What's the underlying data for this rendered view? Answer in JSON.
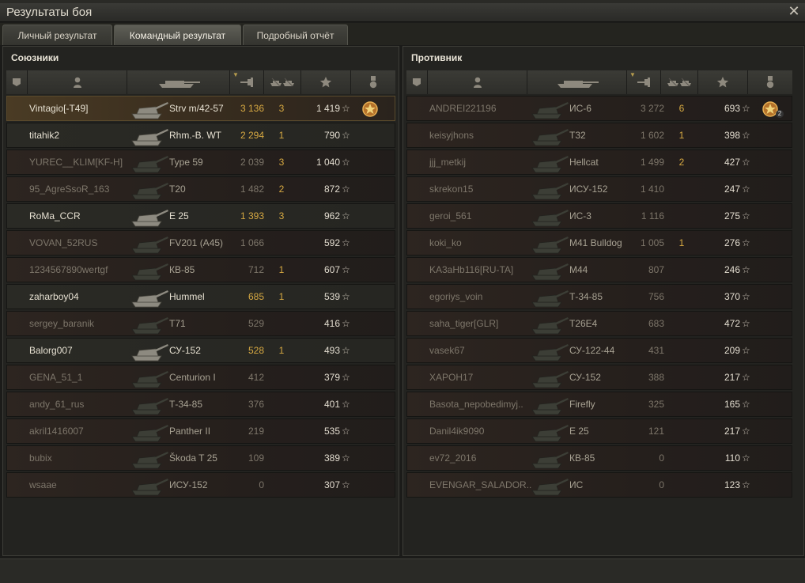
{
  "window": {
    "title": "Результаты боя",
    "close_icon": "close-icon"
  },
  "tabs": [
    {
      "label": "Личный результат"
    },
    {
      "label": "Командный результат"
    },
    {
      "label": "Подробный отчёт"
    }
  ],
  "colors": {
    "gold": "#d7a942",
    "name": "#c8c2b4",
    "dim": "#7d766a",
    "player": "#e6e0d1"
  },
  "allies": {
    "title": "Союзники",
    "rows": [
      {
        "player": "Vintagio[-T49]",
        "tank": "Strv m/42-57",
        "damage": "3 136",
        "kills": "3",
        "xp": "1 419",
        "medal": true,
        "style": "gold",
        "alive": true
      },
      {
        "player": "titahik2",
        "tank": "Rhm.-B. WT",
        "damage": "2 294",
        "kills": "1",
        "xp": "790",
        "style": "alive",
        "alive": true
      },
      {
        "player": "YUREC__KLIM[KF-H]",
        "tank": "Type 59",
        "damage": "2 039",
        "kills": "3",
        "xp": "1 040",
        "style": "dead",
        "alive": false
      },
      {
        "player": "95_AgreSsoR_163",
        "tank": "T20",
        "damage": "1 482",
        "kills": "2",
        "xp": "872",
        "style": "dead",
        "alive": false
      },
      {
        "player": "RoMa_CCR",
        "tank": "E 25",
        "damage": "1 393",
        "kills": "3",
        "xp": "962",
        "style": "alive",
        "alive": true
      },
      {
        "player": "VOVAN_52RUS",
        "tank": "FV201 (A45)",
        "damage": "1 066",
        "kills": "",
        "xp": "592",
        "style": "dead",
        "alive": false
      },
      {
        "player": "1234567890wertgf",
        "tank": "КВ-85",
        "damage": "712",
        "kills": "1",
        "xp": "607",
        "style": "dead",
        "alive": false
      },
      {
        "player": "zaharboy04",
        "tank": "Hummel",
        "damage": "685",
        "kills": "1",
        "xp": "539",
        "style": "alive",
        "alive": true
      },
      {
        "player": "sergey_baranik",
        "tank": "T71",
        "damage": "529",
        "kills": "",
        "xp": "416",
        "style": "dead",
        "alive": false
      },
      {
        "player": "Balorg007",
        "tank": "СУ-152",
        "damage": "528",
        "kills": "1",
        "xp": "493",
        "style": "alive",
        "alive": true
      },
      {
        "player": "GENA_51_1",
        "tank": "Centurion I",
        "damage": "412",
        "kills": "",
        "xp": "379",
        "style": "dead",
        "alive": false
      },
      {
        "player": "andy_61_rus",
        "tank": "Т-34-85",
        "damage": "376",
        "kills": "",
        "xp": "401",
        "style": "dead",
        "alive": false
      },
      {
        "player": "akril1416007",
        "tank": "Panther II",
        "damage": "219",
        "kills": "",
        "xp": "535",
        "style": "dead",
        "alive": false
      },
      {
        "player": "bubix",
        "tank": "Škoda T 25",
        "damage": "109",
        "kills": "",
        "xp": "389",
        "style": "dead",
        "alive": false
      },
      {
        "player": "wsaae",
        "tank": "ИСУ-152",
        "damage": "0",
        "kills": "",
        "xp": "307",
        "style": "dead",
        "alive": false
      }
    ]
  },
  "enemies": {
    "title": "Противник",
    "rows": [
      {
        "player": "ANDREI221196",
        "tank": "ИС-6",
        "damage": "3 272",
        "kills": "6",
        "xp": "693",
        "medal": true,
        "medal_count": "2",
        "style": "dead",
        "alive": false
      },
      {
        "player": "keisyjhons",
        "tank": "T32",
        "damage": "1 602",
        "kills": "1",
        "xp": "398",
        "style": "dead",
        "alive": false
      },
      {
        "player": "jjj_metkij",
        "tank": "Hellcat",
        "damage": "1 499",
        "kills": "2",
        "xp": "427",
        "style": "dead",
        "alive": false
      },
      {
        "player": "skrekon15",
        "tank": "ИСУ-152",
        "damage": "1 410",
        "kills": "",
        "xp": "247",
        "style": "dead",
        "alive": false
      },
      {
        "player": "geroi_561",
        "tank": "ИС-3",
        "damage": "1 116",
        "kills": "",
        "xp": "275",
        "style": "dead",
        "alive": false
      },
      {
        "player": "koki_ko",
        "tank": "M41 Bulldog",
        "damage": "1 005",
        "kills": "1",
        "xp": "276",
        "style": "dead",
        "alive": false
      },
      {
        "player": "KA3aHb116[RU-TA]",
        "tank": "M44",
        "damage": "807",
        "kills": "",
        "xp": "246",
        "style": "dead",
        "alive": false
      },
      {
        "player": "egoriys_voin",
        "tank": "Т-34-85",
        "damage": "756",
        "kills": "",
        "xp": "370",
        "style": "dead",
        "alive": false
      },
      {
        "player": "saha_tiger[GLR]",
        "tank": "T26E4",
        "damage": "683",
        "kills": "",
        "xp": "472",
        "style": "dead",
        "alive": false
      },
      {
        "player": "vasek67",
        "tank": "СУ-122-44",
        "damage": "431",
        "kills": "",
        "xp": "209",
        "style": "dead",
        "alive": false
      },
      {
        "player": "XAPOH17",
        "tank": "СУ-152",
        "damage": "388",
        "kills": "",
        "xp": "217",
        "style": "dead",
        "alive": false
      },
      {
        "player": "Basota_nepobedimyj..",
        "tank": "Firefly",
        "damage": "325",
        "kills": "",
        "xp": "165",
        "style": "dead",
        "alive": false
      },
      {
        "player": "Danil4ik9090",
        "tank": "E 25",
        "damage": "121",
        "kills": "",
        "xp": "217",
        "style": "dead",
        "alive": false
      },
      {
        "player": "ev72_2016",
        "tank": "КВ-85",
        "damage": "0",
        "kills": "",
        "xp": "110",
        "style": "dead",
        "alive": false
      },
      {
        "player": "EVENGAR_SALADOR..",
        "tank": "ИС",
        "damage": "0",
        "kills": "",
        "xp": "123",
        "style": "dead",
        "alive": false
      }
    ]
  }
}
